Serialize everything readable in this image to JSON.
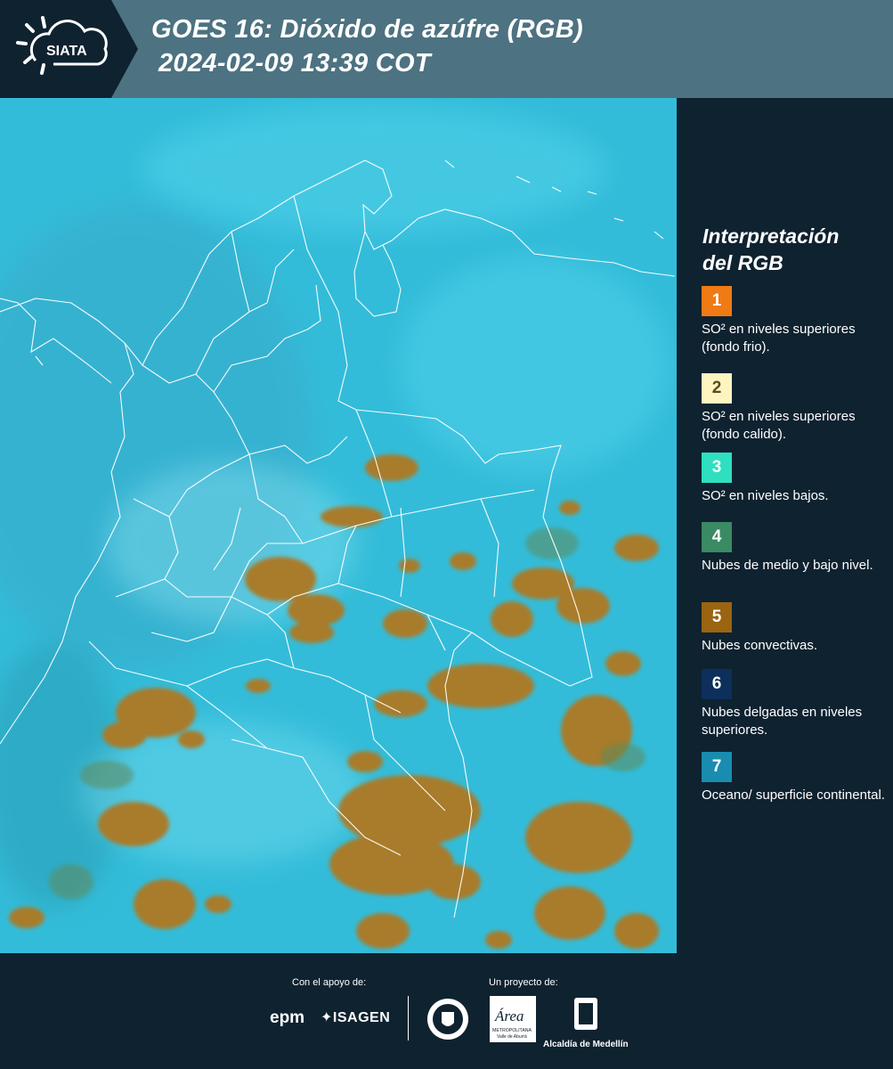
{
  "header": {
    "logo_text": "SIATA",
    "title_line1": "GOES 16: Dióxido de azúfre (RGB)",
    "title_line2": "2024-02-09 13:39 COT"
  },
  "legend": {
    "title_line1": "Interpretación",
    "title_line2": "del RGB",
    "items": [
      {
        "number": "1",
        "color": "#f07a14",
        "description": "SO² en niveles superiores (fondo frio)."
      },
      {
        "number": "2",
        "color": "#fdf5c0",
        "description": "SO² en niveles superiores (fondo calido)."
      },
      {
        "number": "3",
        "color": "#2ee0c0",
        "description": "SO² en niveles bajos."
      },
      {
        "number": "4",
        "color": "#3a8a64",
        "description": "Nubes de medio y bajo nivel."
      },
      {
        "number": "5",
        "color": "#9a6410",
        "description": "Nubes convectivas."
      },
      {
        "number": "6",
        "color": "#0c2f5c",
        "description": "Nubes delgadas en niveles superiores."
      },
      {
        "number": "7",
        "color": "#1a8cb0",
        "description": "Oceano/ superficie continental."
      }
    ]
  },
  "map": {
    "background_color": "#33bcd9",
    "cloud_color": "#a87c2c",
    "border_color": "#ffffff"
  },
  "footer": {
    "support_label": "Con el apoyo de:",
    "project_label": "Un proyecto de:",
    "sponsor1": "epm",
    "sponsor2": "ISAGEN",
    "partner_area_name": "Área",
    "partner_area_sub": "METROPOLITANA",
    "partner_area_sub2": "Valle de Aburrá",
    "partner_alcaldia": "Alcaldía de Medellín"
  }
}
